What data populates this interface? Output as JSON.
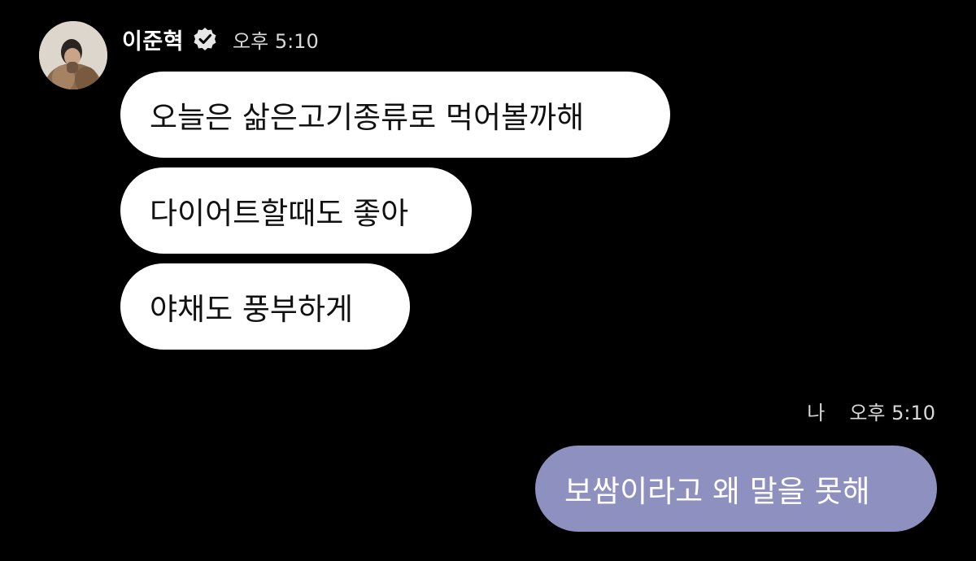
{
  "sender": {
    "name": "이준혁",
    "verified": true,
    "time": "오후 5:10",
    "avatar_icon": "profile-photo"
  },
  "incoming_messages": [
    {
      "text": "오늘은 삶은고기종류로 먹어볼까해"
    },
    {
      "text": "다이어트할때도 좋아"
    },
    {
      "text": "야채도 풍부하게"
    }
  ],
  "me": {
    "label": "나",
    "time": "오후 5:10"
  },
  "outgoing_messages": [
    {
      "text": "보쌈이라고 왜 말을 못해"
    }
  ],
  "colors": {
    "background": "#000000",
    "incoming_bubble": "#ffffff",
    "outgoing_bubble": "#8e90bf"
  }
}
